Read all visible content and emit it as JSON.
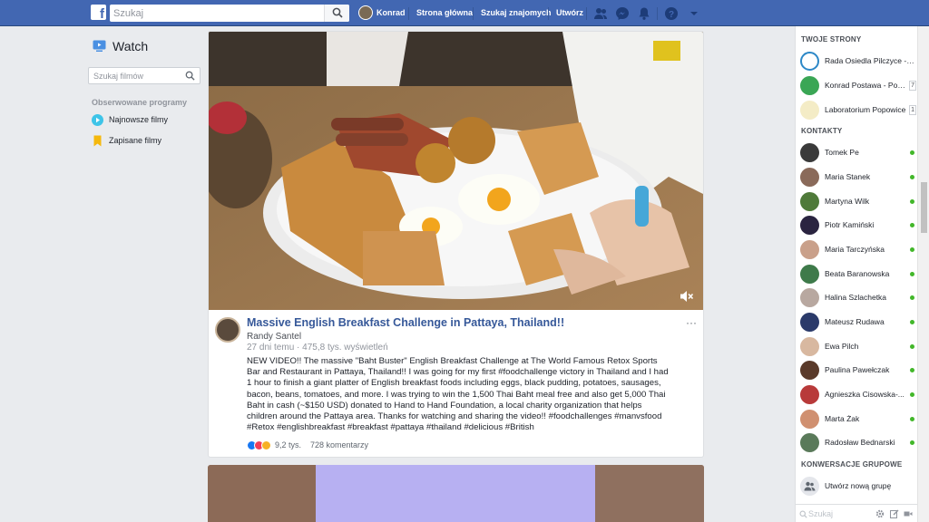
{
  "colors": {
    "brand": "#4267b2",
    "link": "#365899",
    "online": "#42b72a"
  },
  "topbar": {
    "search_placeholder": "Szukaj",
    "user_name": "Konrad",
    "home_label": "Strona główna",
    "find_friends_label": "Szukaj znajomych",
    "create_label": "Utwórz",
    "icons": [
      "friend-requests-icon",
      "messenger-icon",
      "notifications-icon",
      "help-icon",
      "account-menu-icon"
    ]
  },
  "left": {
    "title": "Watch",
    "search_placeholder": "Szukaj filmów",
    "section_label": "Obserwowane programy",
    "items": [
      {
        "label": "Najnowsze filmy",
        "icon": "play-icon"
      },
      {
        "label": "Zapisane filmy",
        "icon": "bookmark-icon"
      }
    ]
  },
  "post": {
    "title": "Massive English Breakfast Challenge in Pattaya, Thailand!!",
    "author": "Randy Santel",
    "meta": "27 dni temu · 475,8 tys. wyświetleń",
    "description": "NEW VIDEO!! The massive \"Baht Buster\" English Breakfast Challenge at The World Famous Retox Sports Bar and Restaurant in Pattaya, Thailand!! I was going for my first #foodchallenge victory in Thailand and I had 1 hour to finish a giant platter of English breakfast foods including eggs, black pudding, potatoes, sausages, bacon, beans, tomatoes, and more. I was trying to win the 1,500 Thai Baht meal free and also get 5,000 Thai Baht in cash (~$150 USD) donated to Hand to Hand Foundation, a local charity organization that helps children around the Pattaya area. Thanks for watching and sharing the video!! #foodchallenges #manvsfood #Retox #englishbreakfast #breakfast #pattaya #thailand #delicious #British",
    "reactions_count": "9,2 tys.",
    "comments": "728 komentarzy",
    "more": "···"
  },
  "right": {
    "pages_header": "TWOJE STRONY",
    "pages": [
      {
        "name": "Rada Osiedla Pilczyce - K...",
        "badge": "",
        "color": "#2d88c7"
      },
      {
        "name": "Konrad Postawa - Post...",
        "badge": "7",
        "color": "#3aa655"
      },
      {
        "name": "Laboratorium Popowice",
        "badge": "1",
        "color": "#e8d07a"
      }
    ],
    "contacts_header": "KONTAKTY",
    "contacts": [
      {
        "name": "Tomek Pe",
        "color": "#3a3a3a"
      },
      {
        "name": "Maria Stanek",
        "color": "#8a6a5a"
      },
      {
        "name": "Martyna Wilk",
        "color": "#4f7a3a"
      },
      {
        "name": "Piotr Kamiński",
        "color": "#2a2440"
      },
      {
        "name": "Maria Tarczyńska",
        "color": "#c9a08a"
      },
      {
        "name": "Beata Baranowska",
        "color": "#3e7a4a"
      },
      {
        "name": "Halina Szlachetka",
        "color": "#b8a8a0"
      },
      {
        "name": "Mateusz Rudawa",
        "color": "#2b3a6a"
      },
      {
        "name": "Ewa Pilch",
        "color": "#d8b8a0"
      },
      {
        "name": "Paulina Pawełczak",
        "color": "#5a3a2a"
      },
      {
        "name": "Agnieszka Cisowska-...",
        "color": "#b83a3a"
      },
      {
        "name": "Marta Żak",
        "color": "#d09070"
      },
      {
        "name": "Radosław Bednarski",
        "color": "#5a7a5a"
      }
    ],
    "group_header": "KONWERSACJE GRUPOWE",
    "new_group_label": "Utwórz nową grupę",
    "bottom_search_placeholder": "Szukaj"
  }
}
